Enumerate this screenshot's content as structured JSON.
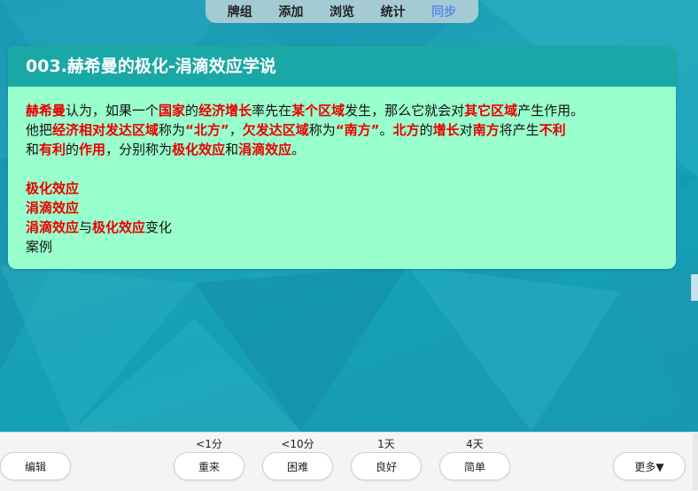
{
  "topnav": {
    "items": [
      {
        "label": "牌组",
        "key": "decks"
      },
      {
        "label": "添加",
        "key": "add"
      },
      {
        "label": "浏览",
        "key": "browse"
      },
      {
        "label": "统计",
        "key": "stats"
      },
      {
        "label": "同步",
        "key": "sync"
      }
    ]
  },
  "card": {
    "title": "003.赫希曼的极化-涓滴效应学说",
    "line1": [
      {
        "t": "赫希曼",
        "hl": true
      },
      {
        "t": "认为，如果一个",
        "hl": false
      },
      {
        "t": "国家",
        "hl": true
      },
      {
        "t": "的",
        "hl": false
      },
      {
        "t": "经济增长",
        "hl": true
      },
      {
        "t": "率先在",
        "hl": false
      },
      {
        "t": "某个区域",
        "hl": true
      },
      {
        "t": "发生，那么它就会对",
        "hl": false
      },
      {
        "t": "其它区域",
        "hl": true
      },
      {
        "t": "产生作用。",
        "hl": false
      }
    ],
    "line2": [
      {
        "t": "他把",
        "hl": false
      },
      {
        "t": "经济相对发达区域",
        "hl": true
      },
      {
        "t": "称为",
        "hl": false
      },
      {
        "t": "“北方”",
        "hl": true
      },
      {
        "t": "，",
        "hl": false
      },
      {
        "t": "欠发达区域",
        "hl": true
      },
      {
        "t": "称为",
        "hl": false
      },
      {
        "t": "“南方”",
        "hl": true
      },
      {
        "t": "。",
        "hl": false
      },
      {
        "t": "北方",
        "hl": true
      },
      {
        "t": "的",
        "hl": false
      },
      {
        "t": "增长",
        "hl": true
      },
      {
        "t": "对",
        "hl": false
      },
      {
        "t": "南方",
        "hl": true
      },
      {
        "t": "将产生",
        "hl": false
      },
      {
        "t": "不利",
        "hl": true
      }
    ],
    "line3": [
      {
        "t": "和",
        "hl": false
      },
      {
        "t": "有利",
        "hl": true
      },
      {
        "t": "的",
        "hl": false
      },
      {
        "t": "作用",
        "hl": true
      },
      {
        "t": "，分别称为",
        "hl": false
      },
      {
        "t": "极化效应",
        "hl": true
      },
      {
        "t": "和",
        "hl": false
      },
      {
        "t": "涓滴效应",
        "hl": true
      },
      {
        "t": "。",
        "hl": false
      }
    ],
    "list1": "极化效应",
    "list2": "涓滴效应",
    "list3": [
      {
        "t": "涓滴效应",
        "hl": true
      },
      {
        "t": "与",
        "hl": false
      },
      {
        "t": "极化效应",
        "hl": true
      },
      {
        "t": "变化",
        "hl": false
      }
    ],
    "list4": "案例"
  },
  "bottombar": {
    "edit_label": "编辑",
    "more_label": "更多▼",
    "answers": [
      {
        "time": "<1分",
        "label": "重来"
      },
      {
        "time": "<10分",
        "label": "困难"
      },
      {
        "time": "1天",
        "label": "良好"
      },
      {
        "time": "4天",
        "label": "简单"
      }
    ]
  },
  "colors": {
    "highlight": "#e80000",
    "card_bg": "#99ffcc",
    "header_bg": "#19a8a5",
    "sync_accent": "#5a8ee6"
  }
}
